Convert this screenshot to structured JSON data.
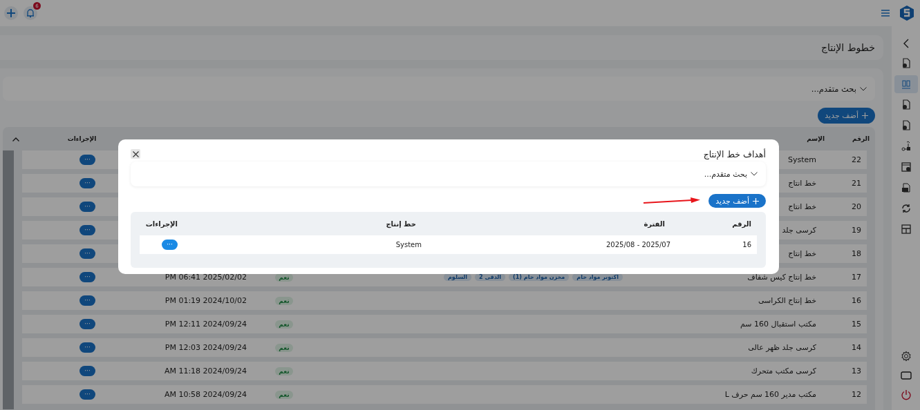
{
  "top_bar": {
    "notification_count": "6"
  },
  "sidebar": {
    "items": [
      {
        "selected": false
      },
      {
        "selected": true
      },
      {
        "selected": false
      },
      {
        "selected": false
      },
      {
        "selected": false
      },
      {
        "selected": false
      },
      {
        "selected": false
      },
      {
        "selected": false
      },
      {
        "selected": false
      }
    ]
  },
  "page": {
    "title": "خطوط الإنتاج",
    "search_label": "بحث متقدم...",
    "add_button": "أضف جديد",
    "table": {
      "columns": {
        "number": "الرقم",
        "name": "الإسم",
        "actions": "الإجراءات"
      },
      "rows": [
        {
          "number": "22",
          "name": "System",
          "action": "···"
        },
        {
          "number": "21",
          "name": "خط انتاج",
          "action": "···"
        },
        {
          "number": "20",
          "name": "خط انتاج",
          "action": "···"
        },
        {
          "number": "19",
          "name": "كرسى جلد",
          "action": "···"
        },
        {
          "number": "18",
          "name": "خط إنتاج",
          "action": "···"
        },
        {
          "number": "17",
          "name": "خط إنتاج كيس شفاف",
          "tags": [
            "اكتوبر مواد خام",
            "مخزن مواد خام (1)",
            "الدقى 2",
            "السلوم"
          ],
          "flag": "نعم",
          "date": "PM 06:41 2025/02/02",
          "action": "···"
        },
        {
          "number": "16",
          "name": "خط إنتاج الكراسى",
          "flag": "نعم",
          "date": "PM 01:19 2024/10/02",
          "action": "···"
        },
        {
          "number": "15",
          "name": "مكتب استقبال 160 سم",
          "flag": "نعم",
          "date": "PM 12:11 2024/09/24",
          "action": "···"
        },
        {
          "number": "14",
          "name": "كرسى جلد ظهر عالى",
          "flag": "نعم",
          "date": "PM 12:03 2024/09/24",
          "action": "···"
        },
        {
          "number": "13",
          "name": "كرسى مكتب متحرك",
          "flag": "نعم",
          "date": "AM 11:18 2024/09/24",
          "action": "···"
        },
        {
          "number": "12",
          "name": "مكتب مدير 160 سم حرف L",
          "flag": "نعم",
          "date": "AM 10:58 2024/09/24",
          "action": "···"
        }
      ]
    }
  },
  "modal": {
    "title": "أهداف خط الإنتاج",
    "search_label": "بحث متقدم...",
    "add_button": "أضف جديد",
    "columns": [
      "الرقم",
      "الفترة",
      "خط إنتاج",
      "الإجراءات"
    ],
    "rows": [
      {
        "number": "16",
        "period": "2025/08 - 2025/07",
        "line": "System",
        "action": "···"
      }
    ]
  }
}
